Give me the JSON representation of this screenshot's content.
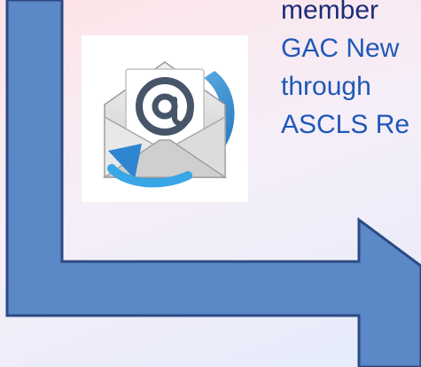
{
  "slide": {
    "text_lines": [
      "member",
      "GAC New",
      "through",
      "ASCLS Re"
    ],
    "colors": {
      "arrow_fill": "#5b88c7",
      "arrow_stroke": "#2c4a82",
      "text_dark": "#1c2b7a",
      "text_blue": "#1f58b8"
    },
    "icons": {
      "email": "email-at-envelope-icon",
      "arrow": "l-shaped-arrow-icon"
    }
  }
}
